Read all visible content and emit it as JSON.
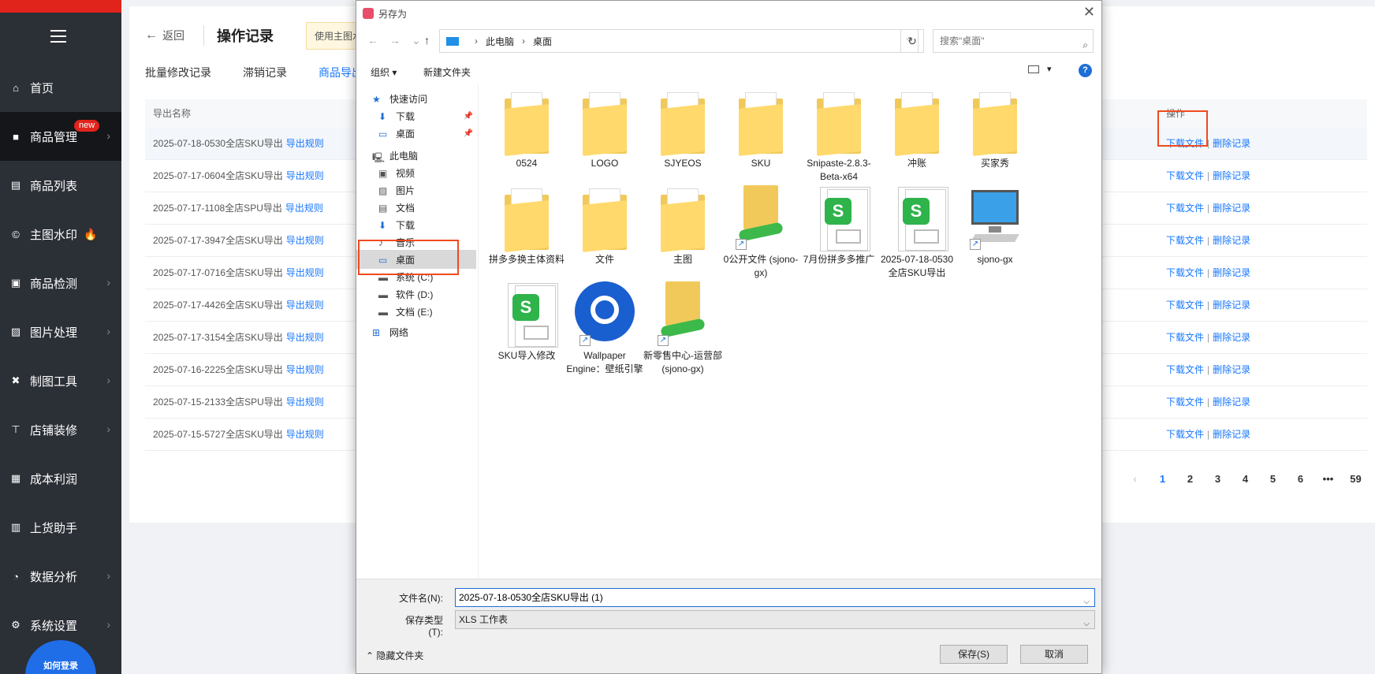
{
  "sidebar": {
    "items": [
      {
        "label": "首页",
        "icon": "home-icon",
        "chevron": false
      },
      {
        "label": "商品管理",
        "icon": "bag-icon",
        "chevron": true,
        "badge": "new",
        "active": true
      },
      {
        "label": "商品列表",
        "icon": "document-icon",
        "chevron": false
      },
      {
        "label": "主图水印",
        "icon": "copyright-icon",
        "chevron": false,
        "fire": true
      },
      {
        "label": "商品检测",
        "icon": "lock-icon",
        "chevron": true
      },
      {
        "label": "图片处理",
        "icon": "image-icon",
        "chevron": true
      },
      {
        "label": "制图工具",
        "icon": "tools-icon",
        "chevron": true
      },
      {
        "label": "店铺装修",
        "icon": "paint-roller-icon",
        "chevron": true
      },
      {
        "label": "成本利润",
        "icon": "printer-icon",
        "chevron": false
      },
      {
        "label": "上货助手",
        "icon": "box-icon",
        "chevron": false
      },
      {
        "label": "数据分析",
        "icon": "pie-chart-icon",
        "chevron": true
      },
      {
        "label": "系统设置",
        "icon": "gear-icon",
        "chevron": true
      }
    ],
    "help_bubble": "如何登录"
  },
  "main": {
    "back_label": "返回",
    "title": "操作记录",
    "notice": "使用主图水",
    "tabs": [
      "批量修改记录",
      "滞销记录",
      "商品导出"
    ],
    "active_tab": 2,
    "table": {
      "col_name": "导出名称",
      "col_ops": "操作",
      "rule_label": "导出规则",
      "download_label": "下载文件",
      "delete_label": "删除记录",
      "rows": [
        "2025-07-18-0530全店SKU导出",
        "2025-07-17-0604全店SKU导出",
        "2025-07-17-1108全店SPU导出",
        "2025-07-17-3947全店SKU导出",
        "2025-07-17-0716全店SKU导出",
        "2025-07-17-4426全店SKU导出",
        "2025-07-17-3154全店SKU导出",
        "2025-07-16-2225全店SKU导出",
        "2025-07-15-2133全店SPU导出",
        "2025-07-15-5727全店SKU导出"
      ]
    },
    "pagination": [
      "1",
      "2",
      "3",
      "4",
      "5",
      "6",
      "•••",
      "59"
    ],
    "current_page": "1"
  },
  "dialog": {
    "title": "另存为",
    "address": {
      "root": "此电脑",
      "folder": "桌面"
    },
    "search_placeholder": "搜索\"桌面\"",
    "organize_label": "组织 ▾",
    "new_folder_label": "新建文件夹",
    "tree": [
      {
        "label": "快速访问",
        "icon": "star-icon",
        "indent": 0
      },
      {
        "label": "下载",
        "icon": "download-icon",
        "indent": 1,
        "pinned": true
      },
      {
        "label": "桌面",
        "icon": "desktop-icon",
        "indent": 1,
        "pinned": true
      },
      {
        "label": "此电脑",
        "icon": "computer-icon",
        "indent": 0
      },
      {
        "label": "视频",
        "icon": "video-icon",
        "indent": 1
      },
      {
        "label": "图片",
        "icon": "picture-icon",
        "indent": 1
      },
      {
        "label": "文档",
        "icon": "doc-icon",
        "indent": 1
      },
      {
        "label": "下载",
        "icon": "download-icon",
        "indent": 1
      },
      {
        "label": "音乐",
        "icon": "music-icon",
        "indent": 1
      },
      {
        "label": "桌面",
        "icon": "desktop-icon",
        "indent": 1,
        "selected": true
      },
      {
        "label": "系统 (C:)",
        "icon": "drive-icon",
        "indent": 1
      },
      {
        "label": "软件 (D:)",
        "icon": "drive-icon",
        "indent": 1
      },
      {
        "label": "文档 (E:)",
        "icon": "drive-icon",
        "indent": 1
      },
      {
        "label": "网络",
        "icon": "network-icon",
        "indent": 0
      }
    ],
    "files": [
      {
        "name": "0524",
        "kind": "folder"
      },
      {
        "name": "LOGO",
        "kind": "folder"
      },
      {
        "name": "SJYEOS",
        "kind": "folder"
      },
      {
        "name": "SKU",
        "kind": "folder"
      },
      {
        "name": "Snipaste-2.8.3-Beta-x64",
        "kind": "folder"
      },
      {
        "name": "冲账",
        "kind": "folder"
      },
      {
        "name": "买家秀",
        "kind": "folder"
      },
      {
        "name": "拼多多换主体资料",
        "kind": "folder"
      },
      {
        "name": "文件",
        "kind": "folder"
      },
      {
        "name": "主图",
        "kind": "folder"
      },
      {
        "name": "0公开文件 (sjono-gx)",
        "kind": "netfolder"
      },
      {
        "name": "7月份拼多多推广",
        "kind": "sheet"
      },
      {
        "name": "2025-07-18-0530全店SKU导出",
        "kind": "sheet"
      },
      {
        "name": "sjono-gx",
        "kind": "monitor"
      },
      {
        "name": "SKU导入修改",
        "kind": "sheet"
      },
      {
        "name": "Wallpaper Engine：壁纸引擎",
        "kind": "gearapp"
      },
      {
        "name": "新零售中心-运营部 (sjono-gx)",
        "kind": "netfolder"
      }
    ],
    "filename_label": "文件名(N):",
    "filename_value": "2025-07-18-0530全店SKU导出 (1)",
    "filetype_label": "保存类型(T):",
    "filetype_value": "XLS 工作表",
    "hide_folders_label": "隐藏文件夹",
    "save_label": "保存(S)",
    "cancel_label": "取消"
  },
  "colors": {
    "accent": "#1677ff",
    "brand": "#e0241c",
    "highlight": "#f04a1e",
    "sidebar": "#2b2f36"
  }
}
